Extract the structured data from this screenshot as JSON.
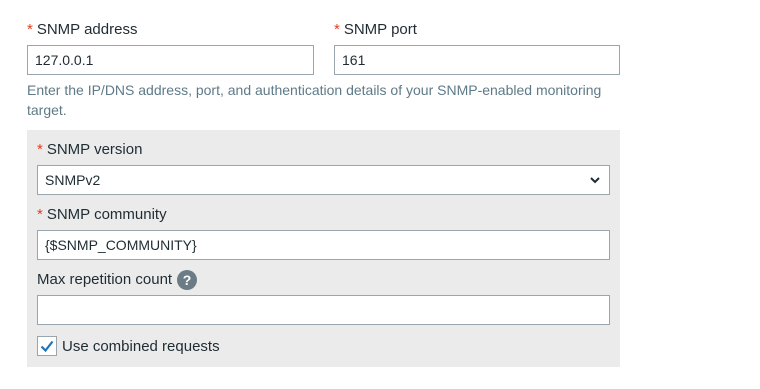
{
  "snmp_address": {
    "required_marker": "*",
    "label": "SNMP address",
    "value": "127.0.0.1"
  },
  "snmp_port": {
    "required_marker": "*",
    "label": "SNMP port",
    "value": "161"
  },
  "hint": "Enter the IP/DNS address, port, and authentication details of your SNMP-enabled monitoring target.",
  "snmp_version": {
    "required_marker": "*",
    "label": "SNMP version",
    "selected": "SNMPv2"
  },
  "snmp_community": {
    "required_marker": "*",
    "label": "SNMP community",
    "value": "{$SNMP_COMMUNITY}"
  },
  "max_repetition": {
    "label": "Max repetition count",
    "help_icon": "question-mark-icon",
    "help_glyph": "?",
    "value": ""
  },
  "combined_requests": {
    "label": "Use combined requests",
    "checked": true
  },
  "colors": {
    "required": "#e53e1e",
    "accent": "#1f74b8",
    "hint": "#5e7a88",
    "panel": "#ebebeb"
  }
}
